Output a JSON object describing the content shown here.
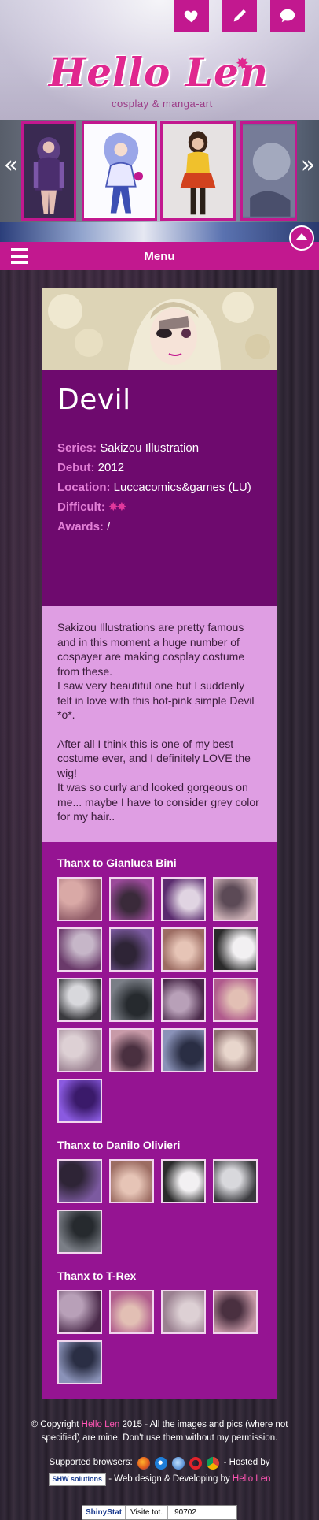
{
  "header": {
    "icons": [
      "heart-icon",
      "pencil-icon",
      "chat-bubble-icon"
    ],
    "logo_title": "Hello Len",
    "logo_subtitle": "cosplay & manga-art"
  },
  "carousel": {
    "prev_label": "«",
    "next_label": "»"
  },
  "menu": {
    "label": "Menu"
  },
  "costume": {
    "title": "Devil",
    "info": [
      {
        "key": "Series:",
        "value": "Sakizou Illustration"
      },
      {
        "key": "Debut:",
        "value": "2012"
      },
      {
        "key": "Location:",
        "value": "Luccacomics&games (LU)"
      },
      {
        "key": "Difficult:",
        "value": "✸✸"
      },
      {
        "key": "Awards:",
        "value": "/"
      }
    ],
    "difficulty_stars": 2,
    "description": [
      "Sakizou Illustrations are pretty famous and in this moment a huge number of cospayer are making cosplay costume from these.",
      "I saw very beautiful one but I suddenly felt in love with this hot-pink simple Devil *o*.",
      "",
      "After all I think this is one of my best costume ever, and I definitely LOVE the wig!",
      "It was so curly and looked gorgeous on me... maybe I have to consider grey color for my hair.."
    ]
  },
  "thanks": [
    {
      "title": "Thanx to Gianluca Bini",
      "photo_count": 17
    },
    {
      "title": "Thanx to Danilo Olivieri",
      "photo_count": 5
    },
    {
      "title": "Thanx to T-Rex",
      "photo_count": 5
    }
  ],
  "footer": {
    "copyright_prefix": "© Copyright ",
    "brand": "Hello Len",
    "copyright_suffix": " 2015 - All the images and pics (where not specified) are mine. Don't use them without my permission.",
    "supported_label": "Supported browsers:",
    "hosted_label": "- Hosted by",
    "host_name": "SHW solutions",
    "design_label": "- Web design & Developing by",
    "counter_brand": "ShinyStat",
    "visits_label": "Visite tot.",
    "visits_value": "90702"
  },
  "colors": {
    "accent": "#c2188f",
    "card_dark": "#6e0a6e",
    "card_light": "#df9ee3",
    "card_gallery": "#951492"
  }
}
